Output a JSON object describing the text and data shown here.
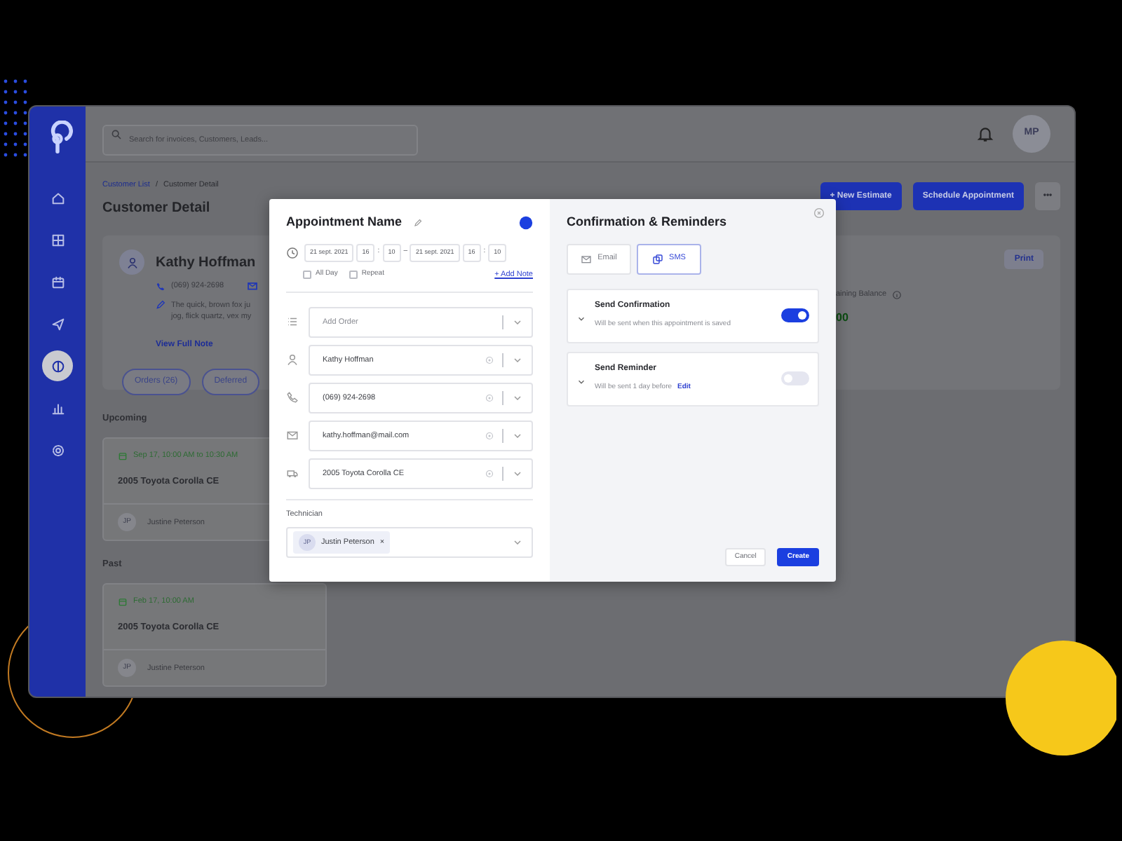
{
  "app": {
    "search": {
      "placeholder": "Search for invoices, Customers, Leads..."
    },
    "avatar": "MP",
    "sidebar": {
      "items": [
        {
          "kind": "home",
          "selected": false
        },
        {
          "kind": "grid",
          "selected": false
        },
        {
          "kind": "calendar",
          "selected": false
        },
        {
          "kind": "send",
          "selected": false
        },
        {
          "kind": "customers",
          "selected": true
        },
        {
          "kind": "chart",
          "selected": false
        },
        {
          "kind": "settings",
          "selected": false
        }
      ]
    },
    "breadcrumb": {
      "link": "Customer List",
      "separator": "/",
      "current": "Customer Detail"
    },
    "page_title": "Customer Detail",
    "header_buttons": [
      {
        "kind": "primary",
        "label": "+ New Estimate"
      },
      {
        "kind": "primary",
        "label": "Schedule Appointment"
      },
      {
        "kind": "more",
        "label": "•••"
      }
    ],
    "customer": {
      "name": "Kathy Hoffman",
      "phone": "(069) 924-2698",
      "note_lines": [
        "The quick, brown fox ju",
        "jog, flick quartz, vex my"
      ],
      "view_note": "View Full Note",
      "print": "Print",
      "balance_label": "aining Balance",
      "balance_value": "00"
    },
    "tabs": [
      {
        "label": "Orders (26)"
      },
      {
        "label": "Deferred"
      }
    ],
    "sections": [
      {
        "title": "Upcoming",
        "appointment": {
          "when": "Sep 17, 10:00 AM to 10:30 AM",
          "vehicle": "2005 Toyota Corolla CE",
          "initials": "JP",
          "technician": "Justine Peterson"
        }
      },
      {
        "title": "Past",
        "appointment": {
          "when": "Feb 17, 10:00 AM",
          "vehicle": "2005 Toyota Corolla CE",
          "initials": "JP",
          "technician": "Justine Peterson"
        }
      }
    ]
  },
  "modal": {
    "title": "Appointment Name",
    "start": {
      "date": "21 sept. 2021",
      "hour": "16",
      "separator": ":",
      "minute": "10"
    },
    "range_separator": "–",
    "end": {
      "date": "21 sept. 2021",
      "hour": "16",
      "separator": ":",
      "minute": "10"
    },
    "checkboxes": [
      {
        "label": "All Day",
        "checked": false
      },
      {
        "label": "Repeat",
        "checked": false
      }
    ],
    "add_note": "+ Add Note",
    "fields": [
      {
        "kind": "order",
        "placeholder": "Add Order"
      },
      {
        "kind": "person",
        "value": "Kathy Hoffman"
      },
      {
        "kind": "phone",
        "value": "(069) 924-2698"
      },
      {
        "kind": "email",
        "value": "kathy.hoffman@mail.com"
      },
      {
        "kind": "vehicle",
        "value": "2005 Toyota Corolla CE"
      }
    ],
    "technician_label": "Technician",
    "technician": {
      "initials": "JP",
      "name": "Justin Peterson",
      "remove": "×"
    },
    "reminders_title": "Confirmation & Reminders",
    "channels": [
      {
        "kind": "email",
        "label": "Email",
        "selected": false
      },
      {
        "kind": "sms",
        "label": "SMS",
        "selected": true
      }
    ],
    "reminders": [
      {
        "title": "Send Confirmation",
        "description": "Will be sent when this appointment is saved",
        "on": true
      },
      {
        "title": "Send Reminder",
        "description": "Will be sent 1 day before",
        "link": "Edit",
        "on": false
      }
    ],
    "cancel": "Cancel",
    "create": "Create"
  }
}
